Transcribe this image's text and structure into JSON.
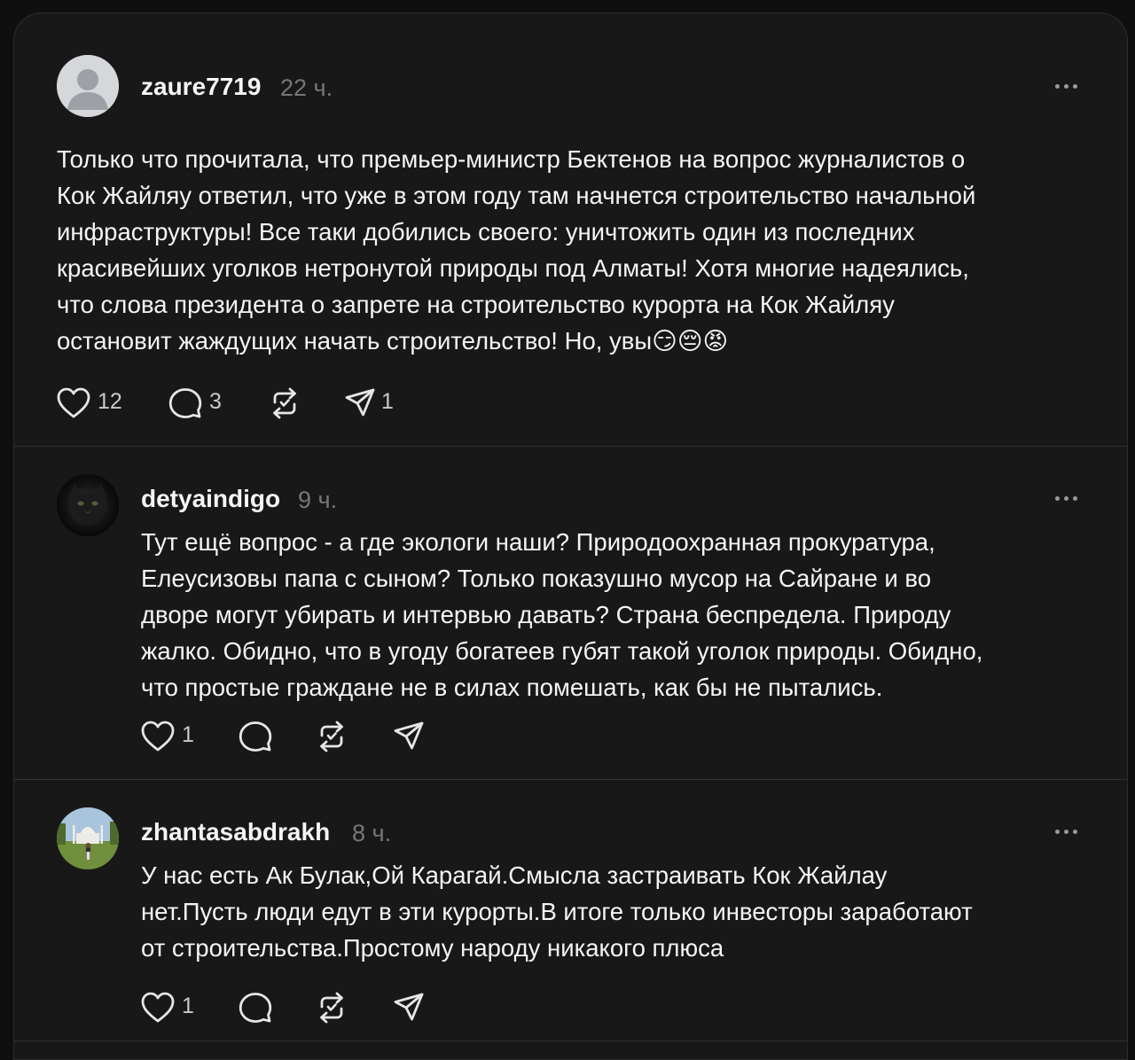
{
  "posts": [
    {
      "username": "zaure7719",
      "time": "22 ч.",
      "text": "Только что прочитала, что премьер-министр Бектенов на вопрос журналистов о\nКок Жайляу ответил, что уже в этом году там начнется строительство начальной\nинфраструктуры! Все таки добились своего: уничтожить один из последних\nкрасивейших уголков нетронутой природы под Алматы! Хотя многие надеялись,\nчто слова президента о запрете на строительство курорта на Кок Жайляу\nостановит жаждущих начать строительство! Но, увы😏😔😡",
      "likes": "12",
      "replies": "3",
      "shares": "1",
      "avatar": "default-avatar-icon"
    },
    {
      "username": "detyaindigo",
      "time": "9 ч.",
      "text": "Тут ещё вопрос - а где экологи наши? Природоохранная прокуратура,\nЕлеусизовы папа с сыном? Только показушно мусор на Сайране и во\nдворе могут убирать и интервью давать? Страна беспредела. Природу\nжалко. Обидно, что в угоду богатеев губят такой уголок природы. Обидно,\nчто простые граждане не в силах помешать, как бы не пытались.",
      "likes": "1",
      "avatar": "cat-photo-avatar"
    },
    {
      "username": "zhantasabdrakh",
      "time": "8 ч.",
      "text": "У нас есть Ак Булак,Ой Карагай.Смысла застраивать Кок Жайлау\nнет.Пусть люди едут в эти курорты.В итоге только инвесторы заработают\nот строительства.Простому народу никакого плюса",
      "likes": "1",
      "avatar": "landmark-photo-avatar"
    }
  ],
  "icons": {
    "like": "heart-icon",
    "reply": "speech-bubble-icon",
    "repost": "repost-icon",
    "share": "paper-plane-icon",
    "more": "more-dots-icon"
  },
  "colors": {
    "background": "#0f0f0f",
    "card": "#181818",
    "text": "#f3f5f7",
    "muted": "#777777",
    "divider": "#323232"
  }
}
